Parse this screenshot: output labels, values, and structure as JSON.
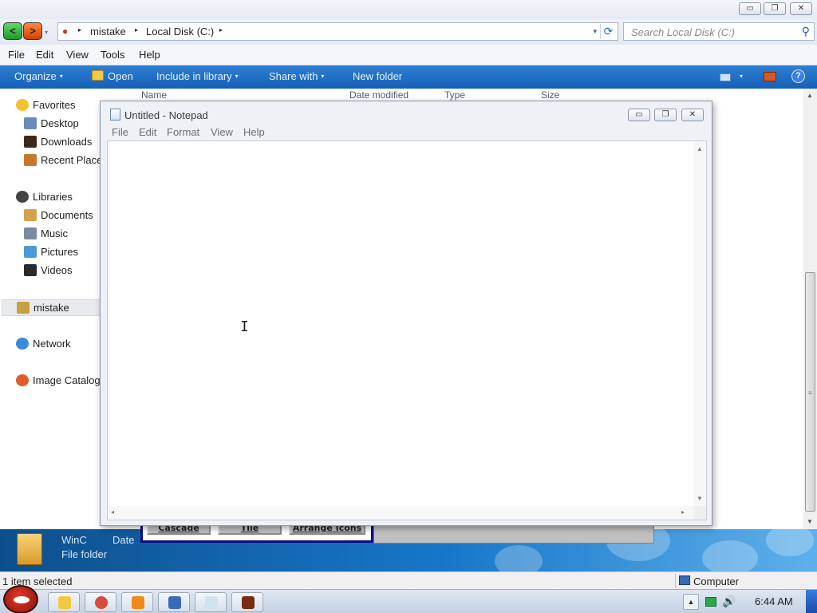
{
  "explorer": {
    "caption_buttons": {
      "minimize": "▭",
      "restore": "❐",
      "close": "✕"
    },
    "nav": {
      "back": "<",
      "forward": ">",
      "history": "▾"
    },
    "breadcrumb": [
      "mistake",
      "Local Disk (C:)"
    ],
    "crumb_arrow": "▸",
    "address_dropdown": "▾",
    "refresh_glyph": "⟳",
    "search_placeholder": "Search Local Disk (C:)",
    "search_glyph": "⚲",
    "menu": [
      "File",
      "Edit",
      "View",
      "Tools",
      "Help"
    ],
    "toolbar": {
      "organize": "Organize",
      "open": "Open",
      "include_in_library": "Include in library",
      "share_with": "Share with",
      "new_folder": "New folder",
      "dropdown_glyph": "▾",
      "help_glyph": "?"
    },
    "columns": [
      "Name",
      "Date modified",
      "Type",
      "Size"
    ],
    "nav_pane": {
      "favorites": "Favorites",
      "desktop": "Desktop",
      "downloads": "Downloads",
      "recent_places": "Recent Places",
      "libraries": "Libraries",
      "documents": "Documents",
      "music": "Music",
      "pictures": "Pictures",
      "videos": "Videos",
      "mistake": "mistake",
      "network": "Network",
      "image_catalog": "Image Catalog"
    },
    "details": {
      "name": "WinC",
      "type": "File folder",
      "date_label": "Date"
    },
    "status_left": "1 item selected",
    "status_right": "Computer",
    "scroll_glyphs": {
      "up": "▲",
      "down": "▼",
      "grip": "≡"
    }
  },
  "background_app": {
    "buttons": [
      "Cascade",
      "Tile",
      "Arrange Icons"
    ]
  },
  "notepad": {
    "title": "Untitled - Notepad",
    "caption_buttons": {
      "minimize": "▭",
      "restore": "❐",
      "close": "✕"
    },
    "menu": [
      "File",
      "Edit",
      "Format",
      "View",
      "Help"
    ],
    "content": "",
    "scroll_glyphs": {
      "up": "▲",
      "down": "▼",
      "left": "◂",
      "right": "▸"
    },
    "cursor": "I"
  },
  "taskbar": {
    "clock": "6:44 AM",
    "tray_up": "▲",
    "volume_glyph": "🔊",
    "apps": [
      {
        "name": "windows-explorer",
        "color": "#f3c844"
      },
      {
        "name": "chrome",
        "color": "#d94a3a"
      },
      {
        "name": "vlc",
        "color": "#f08a1a"
      },
      {
        "name": "virtualbox",
        "color": "#3a6ab8"
      },
      {
        "name": "notepad",
        "color": "#cfe3f1"
      },
      {
        "name": "dosbox",
        "color": "#7a2a10"
      }
    ]
  },
  "colors": {
    "toolbar_blue": "#1f6fc6",
    "details_blue": "#1877c9",
    "window_frame": "#eef1f6"
  }
}
